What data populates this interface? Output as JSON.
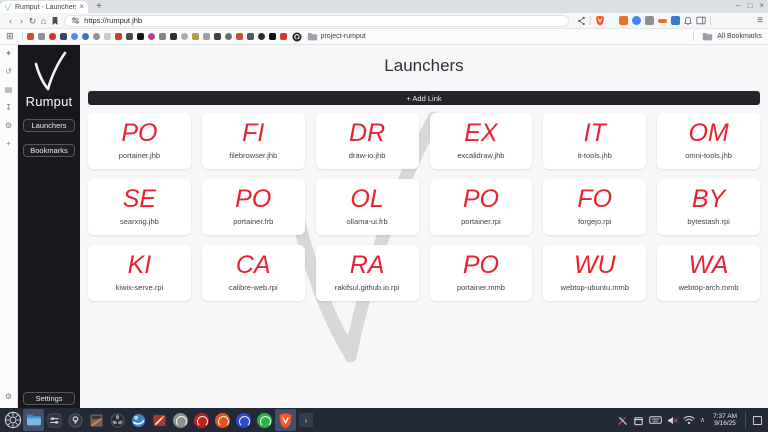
{
  "browser": {
    "tab": {
      "title": "Rumput - Launchers",
      "close_glyph": "×",
      "new_tab_glyph": "+"
    },
    "window_controls": {
      "minimize": "–",
      "maximize": "□",
      "close": "×"
    },
    "nav": {
      "back": "‹",
      "forward": "›",
      "reload": "↻",
      "home": "⌂"
    },
    "url": "https://rumput.jhb",
    "menu_glyph": "≡",
    "bookmarks_bar": {
      "apps_glyph": "⊞",
      "folder_label": "project-rumput",
      "all_bookmarks_label": "All Bookmarks",
      "favicons": [
        {
          "color": "#e0452a",
          "radius": "2px"
        },
        {
          "color": "#8d9196",
          "radius": "2px"
        },
        {
          "color": "#e02d24",
          "radius": "3px"
        },
        {
          "color": "#3e3e68",
          "radius": "2px"
        },
        {
          "color": "#4b8bf5",
          "radius": "50%"
        },
        {
          "color": "#3a6fc8",
          "radius": "50%"
        },
        {
          "color": "#8e9298",
          "radius": "50%"
        },
        {
          "color": "#c7cacd",
          "radius": "2px"
        },
        {
          "color": "#d6392c",
          "radius": "2px"
        },
        {
          "color": "#4a4e54",
          "radius": "2px"
        },
        {
          "color": "#141519",
          "radius": "2px"
        },
        {
          "color": "#bf3a8e",
          "radius": "50%"
        },
        {
          "color": "#808489",
          "radius": "2px"
        },
        {
          "color": "#2e3034",
          "radius": "2px"
        },
        {
          "color": "#a9adb2",
          "radius": "50%"
        },
        {
          "color": "#b9984e",
          "radius": "2px"
        },
        {
          "color": "#9ea2a7",
          "radius": "2px"
        },
        {
          "color": "#3d4146",
          "radius": "2px"
        },
        {
          "color": "#6b6f74",
          "radius": "50%"
        },
        {
          "color": "#c4533a",
          "radius": "2px"
        },
        {
          "color": "#52565c",
          "radius": "2px"
        },
        {
          "color": "#2c2e32",
          "radius": "50%"
        },
        {
          "color": "#101114",
          "radius": "2px"
        },
        {
          "color": "#cf3b36",
          "radius": "2px"
        }
      ]
    },
    "side_strip": {
      "leo_glyph": "✦",
      "history_glyph": "↺",
      "reading_list_glyph": "▤",
      "downloads_glyph": "↧",
      "settings_glyph": "⚙",
      "add_glyph": "+",
      "bottom_settings_glyph": "⚙"
    }
  },
  "sidebar": {
    "brand": "Rumput",
    "items": [
      {
        "label": "Launchers"
      },
      {
        "label": "Bookmarks"
      }
    ],
    "settings_label": "Settings"
  },
  "main": {
    "title": "Launchers",
    "add_link_label": "+ Add Link"
  },
  "launchers": {
    "items": [
      {
        "initials": "PO",
        "label": "portainer.jhb"
      },
      {
        "initials": "FI",
        "label": "filebrowser.jhb"
      },
      {
        "initials": "DR",
        "label": "draw-io.jhb"
      },
      {
        "initials": "EX",
        "label": "excalidraw.jhb"
      },
      {
        "initials": "IT",
        "label": "it-tools.jhb"
      },
      {
        "initials": "OM",
        "label": "omni-tools.jhb"
      },
      {
        "initials": "SE",
        "label": "searxng.jhb"
      },
      {
        "initials": "PO",
        "label": "portainer.frb"
      },
      {
        "initials": "OL",
        "label": "ollama-ui.frb"
      },
      {
        "initials": "PO",
        "label": "portainer.rpi"
      },
      {
        "initials": "FO",
        "label": "forgejo.rpi"
      },
      {
        "initials": "BY",
        "label": "bytestash.rpi"
      },
      {
        "initials": "KI",
        "label": "kiwix-serve.rpi"
      },
      {
        "initials": "CA",
        "label": "calibre-web.rpi"
      },
      {
        "initials": "RA",
        "label": "rakifsul.github.io.rpi"
      },
      {
        "initials": "PO",
        "label": "portainer.mmb"
      },
      {
        "initials": "WU",
        "label": "webtop-ubuntu.mmb"
      },
      {
        "initials": "WA",
        "label": "webtop-arch.mmb"
      }
    ]
  },
  "taskbar": {
    "overflow_glyph": "›",
    "caret_glyph": "∧",
    "clock_time": "7:37 AM",
    "clock_date": "9/16/25",
    "app_dots": [
      {
        "color": "#8f9089"
      },
      {
        "color": "#c0221f"
      },
      {
        "color": "#e0571e"
      },
      {
        "color": "#2b4bd8"
      },
      {
        "color": "#2fb344"
      }
    ]
  },
  "colors": {
    "accent_red": "#e8232e",
    "brave_orange": "#fb542b",
    "taskbar_bg": "#242937",
    "sidebar_bg": "#17181b"
  }
}
